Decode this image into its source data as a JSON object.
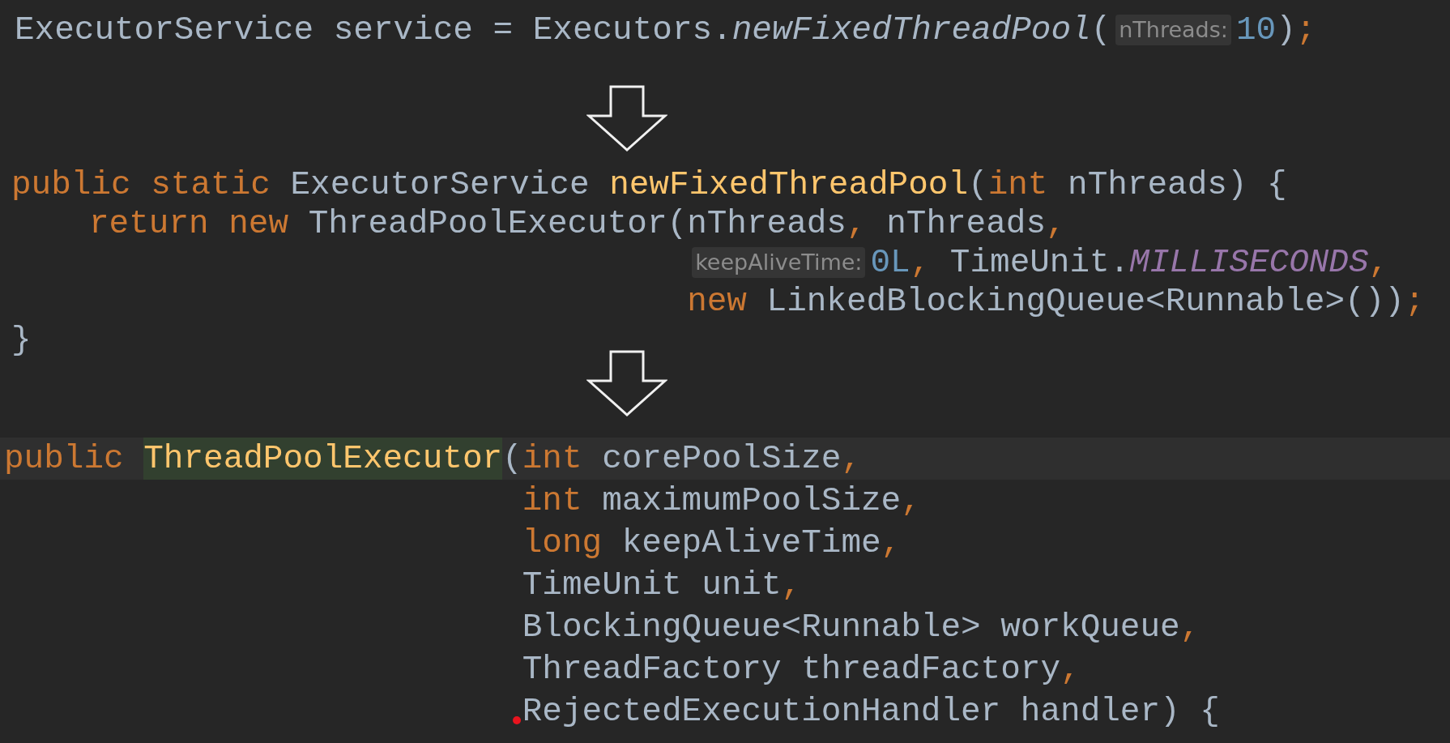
{
  "statement": {
    "tokens": [
      {
        "text": "ExecutorService service = Executors.",
        "kind": "plain"
      },
      {
        "text": "newFixedThreadPool",
        "kind": "static_call"
      },
      {
        "text": "(",
        "kind": "plain"
      },
      {
        "text": "nThreads:",
        "kind": "hint"
      },
      {
        "text": "10",
        "kind": "number"
      },
      {
        "text": ")",
        "kind": "plain"
      },
      {
        "text": ";",
        "kind": "punct"
      }
    ]
  },
  "method": {
    "signature": [
      {
        "text": "public static ",
        "kind": "keyword"
      },
      {
        "text": "ExecutorService ",
        "kind": "plain"
      },
      {
        "text": "newFixedThreadPool",
        "kind": "method_decl"
      },
      {
        "text": "(",
        "kind": "plain"
      },
      {
        "text": "int ",
        "kind": "keyword"
      },
      {
        "text": "nThreads) {",
        "kind": "plain"
      }
    ],
    "call": [
      {
        "text": "return new ",
        "kind": "keyword"
      },
      {
        "text": "ThreadPoolExecutor(",
        "kind": "plain"
      }
    ],
    "args": [
      [
        {
          "text": "nThreads",
          "kind": "plain"
        },
        {
          "text": ",",
          "kind": "punct"
        },
        {
          "text": " nThreads",
          "kind": "plain"
        },
        {
          "text": ",",
          "kind": "punct"
        }
      ],
      [
        {
          "text": "keepAliveTime:",
          "kind": "hint"
        },
        {
          "text": "0L",
          "kind": "number"
        },
        {
          "text": ",",
          "kind": "punct"
        },
        {
          "text": " TimeUnit.",
          "kind": "plain"
        },
        {
          "text": "MILLISECONDS",
          "kind": "constant"
        },
        {
          "text": ",",
          "kind": "punct"
        }
      ],
      [
        {
          "text": "new ",
          "kind": "keyword"
        },
        {
          "text": "LinkedBlockingQueue<Runnable>())",
          "kind": "plain"
        },
        {
          "text": ";",
          "kind": "punct"
        }
      ]
    ],
    "closing": [
      {
        "text": "}",
        "kind": "plain"
      }
    ]
  },
  "constructor": {
    "current_line": true,
    "signature": [
      {
        "text": "public ",
        "kind": "keyword"
      },
      {
        "text": "ThreadPoolExecutor",
        "kind": "declared"
      },
      {
        "text": "(",
        "kind": "plain"
      }
    ],
    "params": [
      [
        {
          "text": "int ",
          "kind": "keyword"
        },
        {
          "text": "corePoolSize",
          "kind": "plain"
        },
        {
          "text": ",",
          "kind": "punct"
        }
      ],
      [
        {
          "text": "int ",
          "kind": "keyword"
        },
        {
          "text": "maximumPoolSize",
          "kind": "plain"
        },
        {
          "text": ",",
          "kind": "punct"
        }
      ],
      [
        {
          "text": "long ",
          "kind": "keyword"
        },
        {
          "text": "keepAliveTime",
          "kind": "plain"
        },
        {
          "text": ",",
          "kind": "punct"
        }
      ],
      [
        {
          "text": "TimeUnit unit",
          "kind": "plain"
        },
        {
          "text": ",",
          "kind": "punct"
        }
      ],
      [
        {
          "text": "BlockingQueue<Runnable> workQueue",
          "kind": "plain"
        },
        {
          "text": ",",
          "kind": "punct"
        }
      ],
      [
        {
          "text": "ThreadFactory threadFactory",
          "kind": "plain"
        },
        {
          "text": ",",
          "kind": "punct"
        }
      ],
      [
        {
          "text": "RejectedExecutionHandler handler) {",
          "kind": "plain"
        }
      ]
    ]
  }
}
